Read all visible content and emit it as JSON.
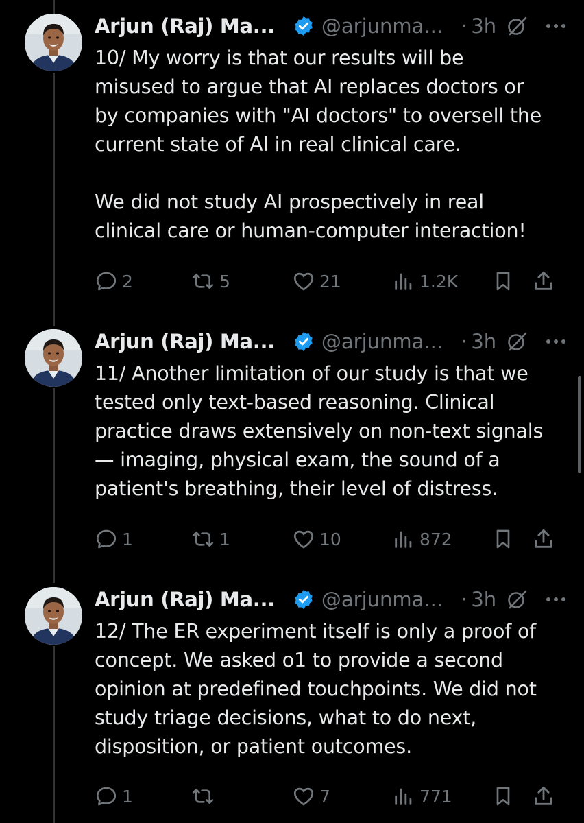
{
  "colors": {
    "background": "#000000",
    "text_primary": "#e7e9ea",
    "text_secondary": "#71767b",
    "verified_badge": "#1d9bf0",
    "thread_line": "#333639"
  },
  "icons": {
    "verified": "verified-badge-icon",
    "grok": "grok-icon",
    "more": "more-dots-icon",
    "reply": "reply-icon",
    "retweet": "retweet-icon",
    "like": "heart-icon",
    "views": "views-bar-icon",
    "bookmark": "bookmark-icon",
    "share": "share-icon"
  },
  "tweets": [
    {
      "author_name": "Arjun (Raj) Ma...",
      "handle": "@arjunma...",
      "dot": "·",
      "time": "3h",
      "text": "10/ My worry is that our results will be\nmisused to argue that AI replaces doctors or\nby companies with \"AI doctors\" to oversell the\ncurrent state of AI in real clinical care.\n\nWe did not study AI prospectively in real\nclinical care or human-computer interaction!",
      "replies": "2",
      "reposts": "5",
      "likes": "21",
      "views": "1.2K"
    },
    {
      "author_name": "Arjun (Raj) Ma...",
      "handle": "@arjunma...",
      "dot": "·",
      "time": "3h",
      "text": "11/ Another limitation of our study is that we\ntested only text-based reasoning. Clinical\npractice draws extensively on non-text signals\n— imaging, physical exam, the sound of a\npatient's breathing, their level of distress.",
      "replies": "1",
      "reposts": "1",
      "likes": "10",
      "views": "872"
    },
    {
      "author_name": "Arjun (Raj) Ma...",
      "handle": "@arjunma...",
      "dot": "·",
      "time": "3h",
      "text": "12/ The ER experiment itself is only a proof of\nconcept. We asked o1 to provide a second\nopinion at predefined touchpoints. We did not\nstudy triage decisions, what to do next,\ndisposition, or patient outcomes.",
      "replies": "1",
      "reposts": "",
      "likes": "7",
      "views": "771"
    }
  ]
}
